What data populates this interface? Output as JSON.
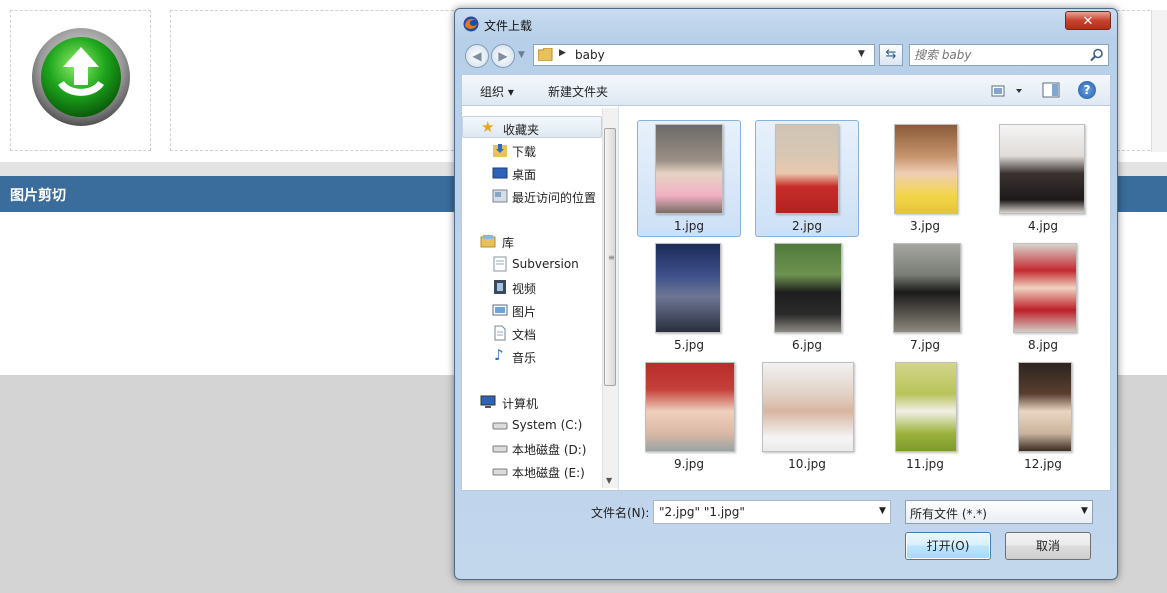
{
  "page": {
    "section_title": "图片剪切"
  },
  "dialog": {
    "title": "文件上载",
    "close_label": "✕",
    "address": {
      "path": "baby"
    },
    "search": {
      "placeholder": "搜索 baby"
    },
    "toolbar": {
      "organize": "组织",
      "new_folder": "新建文件夹",
      "help": "?"
    },
    "nav": {
      "favorites": "收藏夹",
      "favorites_items": [
        "下载",
        "桌面",
        "最近访问的位置"
      ],
      "libraries": "库",
      "libraries_items": [
        "Subversion",
        "视频",
        "图片",
        "文档",
        "音乐"
      ],
      "computer": "计算机",
      "computer_items": [
        "System (C:)",
        "本地磁盘 (D:)",
        "本地磁盘 (E:)"
      ]
    },
    "files": [
      {
        "name": "1.jpg",
        "selected": true
      },
      {
        "name": "2.jpg",
        "selected": true
      },
      {
        "name": "3.jpg",
        "selected": false
      },
      {
        "name": "4.jpg",
        "selected": false
      },
      {
        "name": "5.jpg",
        "selected": false
      },
      {
        "name": "6.jpg",
        "selected": false
      },
      {
        "name": "7.jpg",
        "selected": false
      },
      {
        "name": "8.jpg",
        "selected": false
      },
      {
        "name": "9.jpg",
        "selected": false
      },
      {
        "name": "10.jpg",
        "selected": false
      },
      {
        "name": "11.jpg",
        "selected": false
      },
      {
        "name": "12.jpg",
        "selected": false
      }
    ],
    "footer": {
      "filename_label": "文件名(N):",
      "filename_value": "\"2.jpg\" \"1.jpg\"",
      "filetype_value": "所有文件 (*.*)",
      "open_button": "打开(O)",
      "cancel_button": "取消"
    }
  },
  "colors": {
    "accent_bar": "#3a6d9c",
    "selection": "#cde0f6",
    "close_button": "#c7422c"
  }
}
